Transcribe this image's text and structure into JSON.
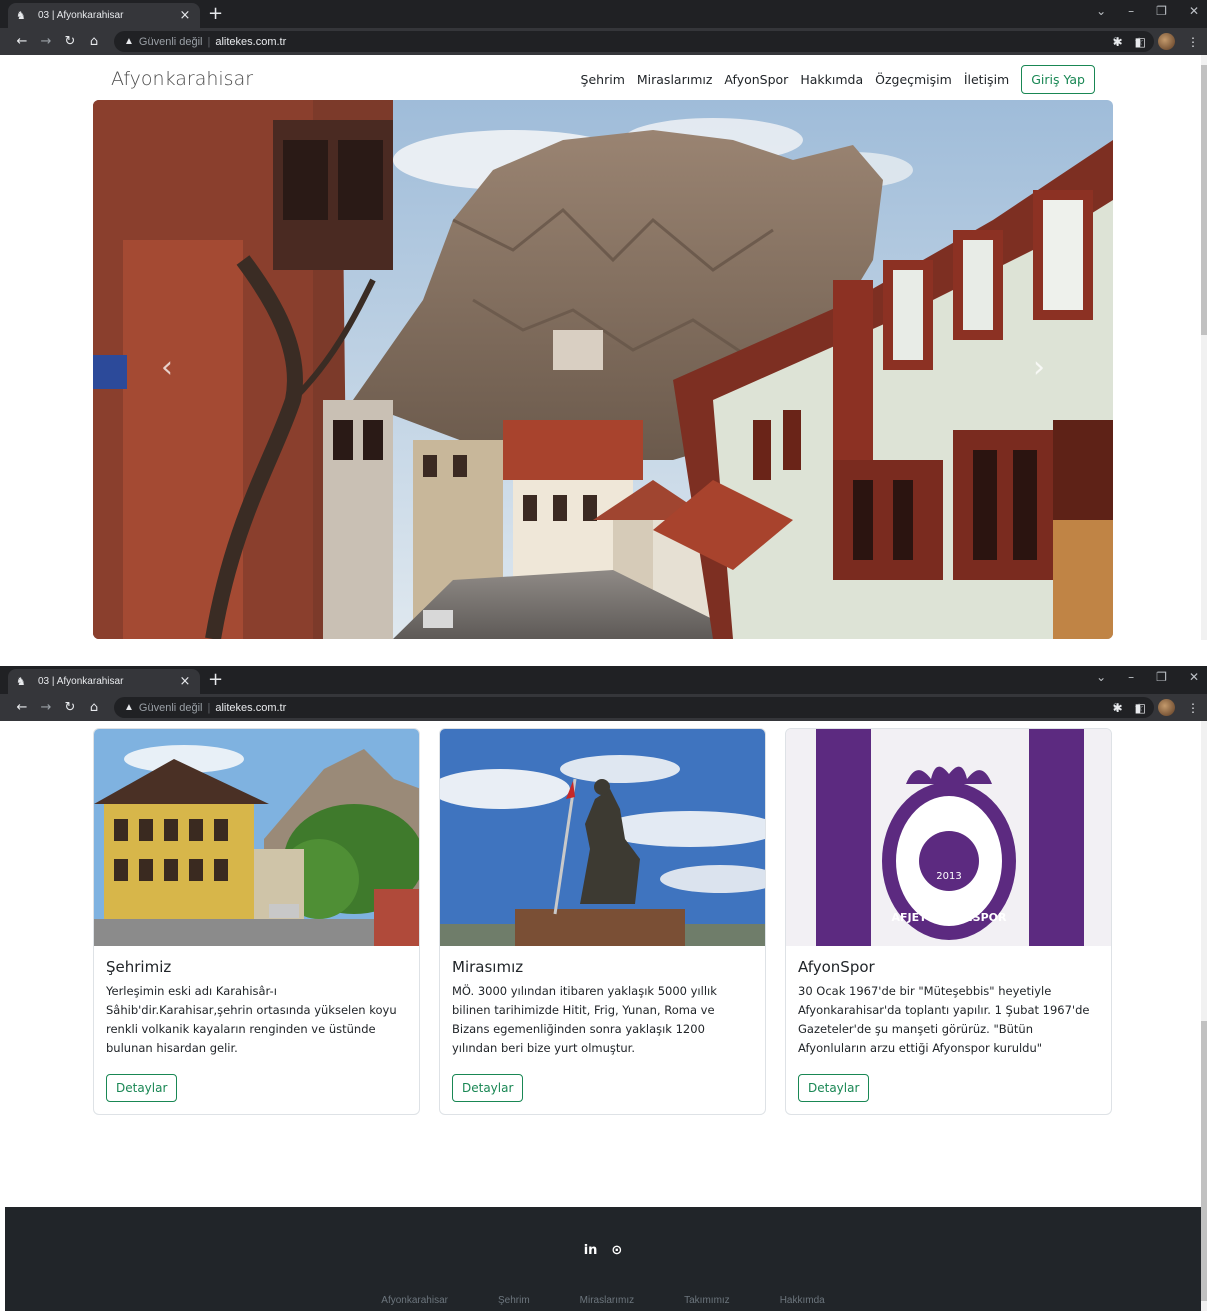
{
  "browser": {
    "tab_title": "03 | Afyonkarahisar",
    "security_label": "Güvenli değil",
    "url": "alitekes.com.tr"
  },
  "navbar": {
    "brand": "Afyonkarahisar",
    "items": [
      "Şehrim",
      "Miraslarımız",
      "AfyonSpor",
      "Hakkımda",
      "Özgeçmişim",
      "İletişim"
    ],
    "login_label": "Giriş Yap"
  },
  "carousel": {
    "prev": "‹",
    "next": "›"
  },
  "cards": [
    {
      "title": "Şehrimiz",
      "text": "Yerleşimin eski adı Karahisâr-ı Sâhib'dir.Karahisar,şehrin ortasında yükselen koyu renkli volkanik kayaların renginden ve üstünde bulunan hisardan gelir.",
      "button": "Detaylar"
    },
    {
      "title": "Mirasımız",
      "text": "MÖ. 3000 yılından itibaren yaklaşık 5000 yıllık bilinen tarihimizde Hitit, Frig, Yunan, Roma ve Bizans egemenliğinden sonra yaklaşık 1200 yılından beri bize yurt olmuştur.",
      "button": "Detaylar"
    },
    {
      "title": "AfyonSpor",
      "text": "30 Ocak 1967'de bir \"Müteşebbis\" heyetiyle Afyonkarahisar'da toplantı yapılır. 1 Şubat 1967'de Gazeteler'de şu manşeti görürüz. \"Bütün Afyonluların arzu ettiği Afyonspor kuruldu\"",
      "button": "Detaylar"
    }
  ],
  "afyonspor_logo": {
    "year": "2013",
    "name": "AFJET AFYONSPOR"
  },
  "footer": {
    "social": [
      {
        "icon": "linkedin-icon",
        "glyph": "in"
      },
      {
        "icon": "github-icon",
        "glyph": "⊙"
      }
    ],
    "links": [
      "Afyonkarahisar",
      "Şehrim",
      "Miraslarımız",
      "Takımımız",
      "Hakkımda"
    ]
  },
  "colors": {
    "accent_green": "#198754",
    "footer_bg": "#212529",
    "chrome_dark": "#202124"
  }
}
